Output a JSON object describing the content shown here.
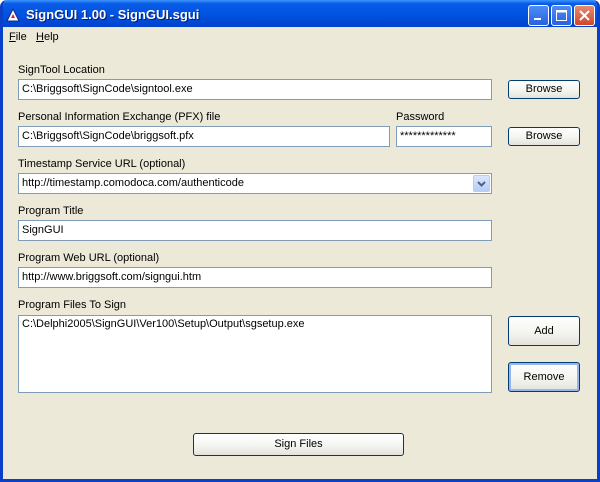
{
  "window": {
    "title": "SignGUI 1.00 - SignGUI.sgui"
  },
  "menu": [
    {
      "label": "File",
      "accel": "F",
      "rest": "ile"
    },
    {
      "label": "Help",
      "accel": "H",
      "rest": "elp"
    }
  ],
  "signtool": {
    "label": "SignTool Location",
    "value": "C:\\Briggsoft\\SignCode\\signtool.exe",
    "browse_label": "Browse"
  },
  "pfx": {
    "label": "Personal Information Exchange (PFX) file",
    "value": "C:\\Briggsoft\\SignCode\\briggsoft.pfx",
    "browse_label": "Browse"
  },
  "password": {
    "label": "Password",
    "value": "*************"
  },
  "timestamp": {
    "label": "Timestamp Service URL (optional)",
    "value": "http://timestamp.comodoca.com/authenticode"
  },
  "program_title": {
    "label": "Program Title",
    "value": "SignGUI"
  },
  "program_url": {
    "label": "Program Web URL (optional)",
    "value": "http://www.briggsoft.com/signgui.htm"
  },
  "program_files": {
    "label": "Program Files To Sign",
    "items": [
      "C:\\Delphi2005\\SignGUI\\Ver100\\Setup\\Output\\sgsetup.exe"
    ],
    "add_label": "Add",
    "remove_label": "Remove"
  },
  "sign_button": {
    "label": "Sign Files"
  },
  "icons": [
    "app-icon",
    "minimize-icon",
    "maximize-icon",
    "close-icon",
    "chevron-down-icon"
  ],
  "colors": {
    "titlebar": "#0054e3",
    "window_bg": "#ece9d8",
    "close_button": "#d2452a",
    "field_border": "#7f9db9"
  }
}
